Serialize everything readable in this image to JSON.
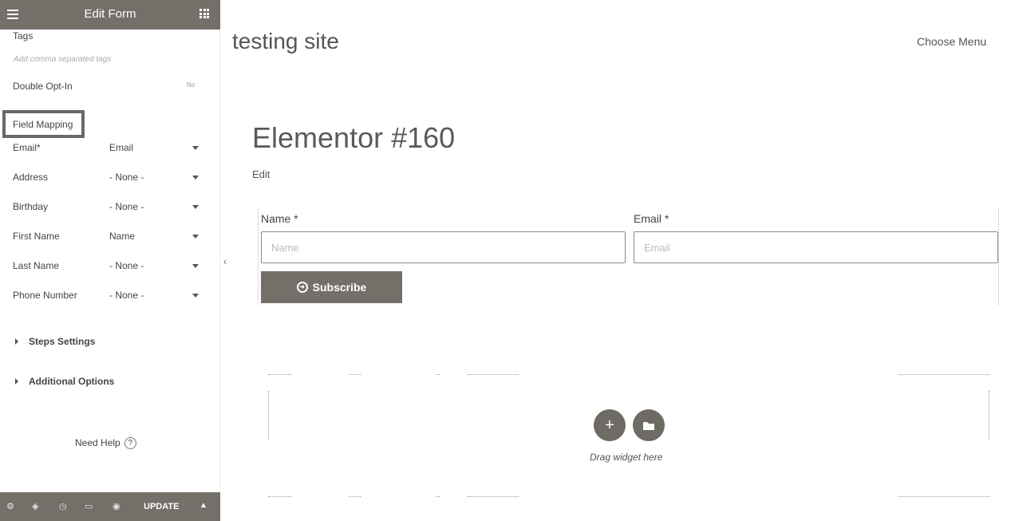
{
  "panel": {
    "title": "Edit Form",
    "tags_label": "Tags",
    "tags_placeholder": "Add comma separated tags",
    "double_optin_label": "Double Opt-In",
    "double_optin_toggle": "No",
    "field_mapping_label": "Field Mapping",
    "mapping": [
      {
        "label": "Email*",
        "value": "Email"
      },
      {
        "label": "Address",
        "value": "- None -"
      },
      {
        "label": "Birthday",
        "value": "- None -"
      },
      {
        "label": "First Name",
        "value": "Name"
      },
      {
        "label": "Last Name",
        "value": "- None -"
      },
      {
        "label": "Phone Number",
        "value": "- None -"
      }
    ],
    "sections": [
      "Steps Settings",
      "Additional Options"
    ],
    "need_help": "Need Help",
    "footer": {
      "update_label": "UPDATE"
    }
  },
  "site": {
    "title": "testing site",
    "menu": "Choose Menu"
  },
  "page": {
    "heading": "Elementor #160",
    "edit_link": "Edit"
  },
  "form": {
    "name_label": "Name *",
    "name_placeholder": "Name",
    "email_label": "Email *",
    "email_placeholder": "Email",
    "subscribe_label": "Subscribe"
  },
  "dropzone": {
    "text": "Drag widget here"
  },
  "colors": {
    "panel_bar": "#747069",
    "button": "#747069",
    "text": "#555555"
  }
}
